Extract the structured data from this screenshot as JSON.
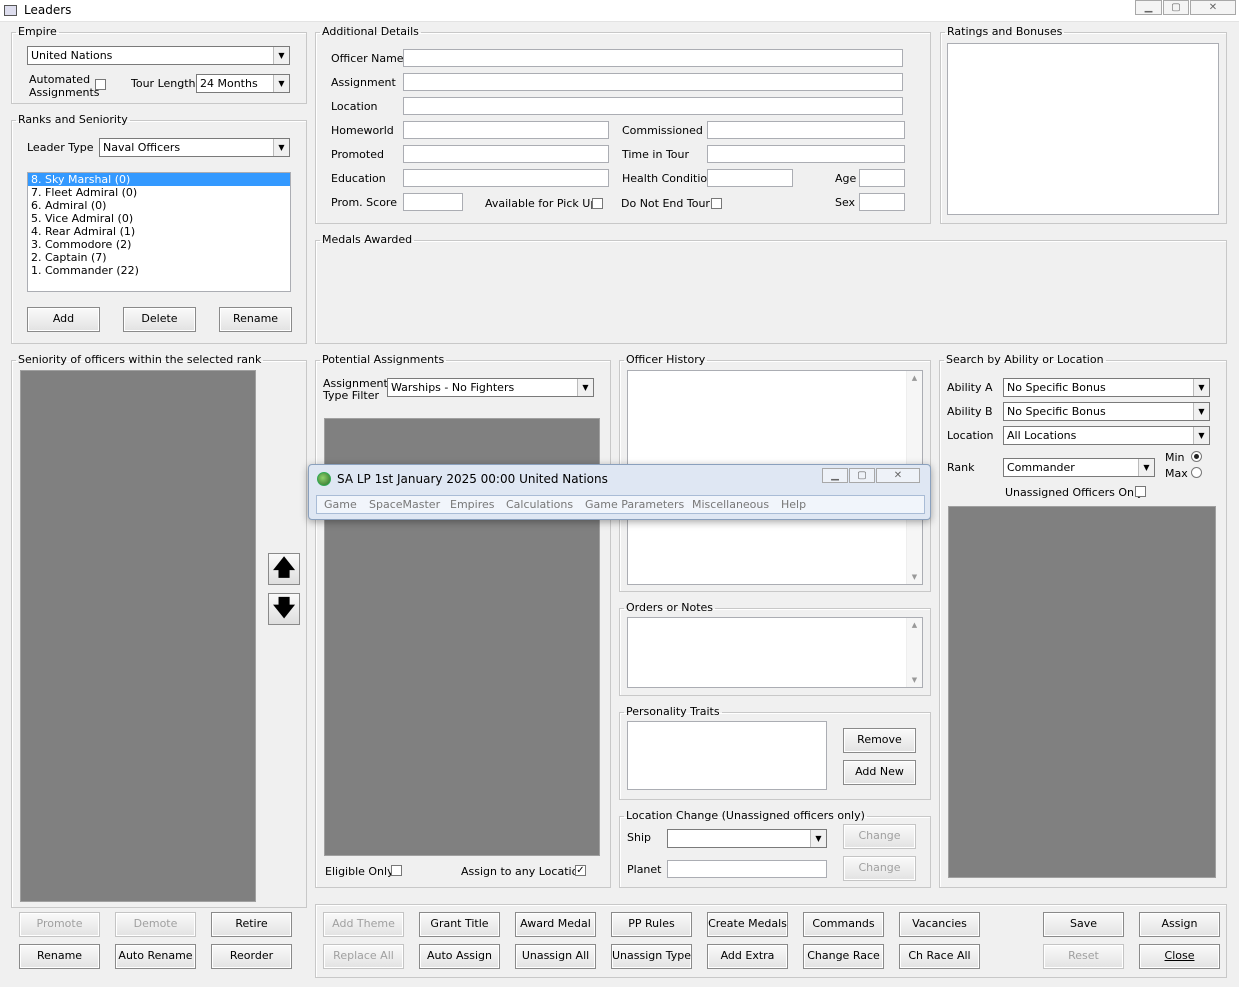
{
  "window": {
    "title": "Leaders",
    "minimize": "▁",
    "maximize": "▢",
    "close": "✕"
  },
  "empire": {
    "legend": "Empire",
    "value": "United Nations",
    "automated_label": "Automated\nAssignments",
    "tour_length_label": "Tour Length",
    "tour_length_value": "24 Months"
  },
  "ranks": {
    "legend": "Ranks and Seniority",
    "leader_type_label": "Leader Type",
    "leader_type_value": "Naval Officers",
    "items": [
      "8. Sky Marshal  (0)",
      "7. Fleet Admiral  (0)",
      "6. Admiral  (0)",
      "5. Vice Admiral  (0)",
      "4. Rear Admiral  (1)",
      "3. Commodore  (2)",
      "2. Captain  (7)",
      "1. Commander  (22)"
    ],
    "add": "Add",
    "delete": "Delete",
    "rename": "Rename"
  },
  "details": {
    "legend": "Additional Details",
    "officer_name": "Officer Name",
    "assignment": "Assignment",
    "location": "Location",
    "homeworld": "Homeworld",
    "commissioned": "Commissioned",
    "promoted": "Promoted",
    "time_in_tour": "Time in Tour",
    "education": "Education",
    "health_condition": "Health Condition",
    "age": "Age",
    "prom_score": "Prom. Score",
    "available_pickup": "Available for Pick Up",
    "do_not_end_tour": "Do Not End Tour",
    "sex": "Sex"
  },
  "ratings": {
    "legend": "Ratings and Bonuses"
  },
  "medals": {
    "legend": "Medals Awarded"
  },
  "seniority": {
    "legend": "Seniority of officers within the selected rank",
    "up": "🡅",
    "down": "🡇"
  },
  "potential": {
    "legend": "Potential Assignments",
    "filter_label": "Assignment\nType Filter",
    "filter_value": "Warships - No Fighters",
    "eligible_only": "Eligible Only",
    "assign_any": "Assign to any Location"
  },
  "history": {
    "legend": "Officer History"
  },
  "orders": {
    "legend": "Orders or Notes"
  },
  "traits": {
    "legend": "Personality Traits",
    "remove": "Remove",
    "add_new": "Add New"
  },
  "location_change": {
    "legend": "Location Change (Unassigned officers only)",
    "ship": "Ship",
    "planet": "Planet",
    "change": "Change"
  },
  "search": {
    "legend": "Search by Ability or Location",
    "ability_a": "Ability A",
    "ability_a_value": "No Specific Bonus",
    "ability_b": "Ability B",
    "ability_b_value": "No Specific Bonus",
    "location": "Location",
    "location_value": "All Locations",
    "rank": "Rank",
    "rank_value": "Commander",
    "min": "Min",
    "max": "Max",
    "unassigned_only": "Unassigned Officers Only"
  },
  "left_buttons": {
    "promote": "Promote",
    "demote": "Demote",
    "retire": "Retire",
    "rename": "Rename",
    "auto_rename": "Auto Rename",
    "reorder": "Reorder"
  },
  "bottom_buttons": {
    "add_theme": "Add Theme",
    "grant_title": "Grant Title",
    "award_medal": "Award Medal",
    "pp_rules": "PP Rules",
    "create_medals": "Create Medals",
    "commands": "Commands",
    "vacancies": "Vacancies",
    "save": "Save",
    "assign": "Assign",
    "replace_all": "Replace All",
    "auto_assign": "Auto Assign",
    "unassign_all": "Unassign All",
    "unassign_type": "Unassign Type",
    "add_extra": "Add Extra",
    "change_race": "Change Race",
    "ch_race_all": "Ch Race All",
    "reset": "Reset",
    "close": "Close"
  },
  "popup": {
    "title": "SA LP  1st January 2025 00:00   United Nations",
    "menu": [
      "Game",
      "SpaceMaster",
      "Empires",
      "Calculations",
      "Game Parameters",
      "Miscellaneous",
      "Help"
    ]
  },
  "icons": {
    "check": "✓",
    "dropdown": "▼",
    "scroll_up": "▲",
    "scroll_down": "▼"
  }
}
